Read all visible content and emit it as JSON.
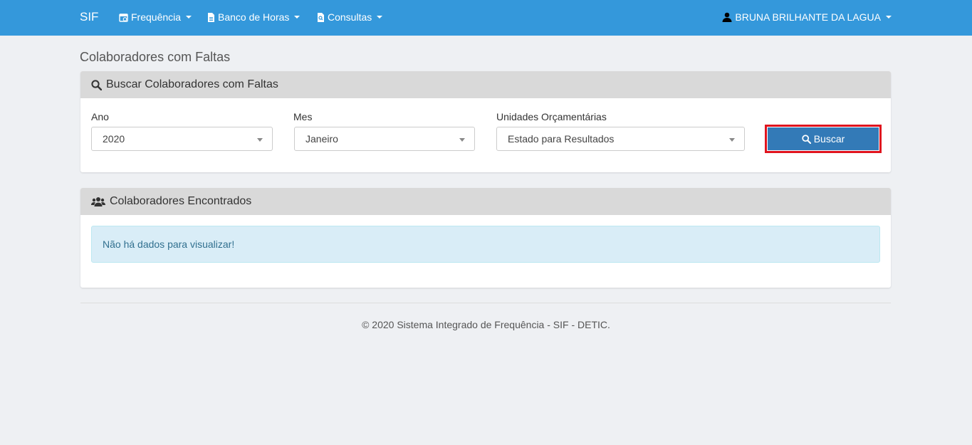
{
  "navbar": {
    "brand": "SIF",
    "items": [
      {
        "label": "Frequência"
      },
      {
        "label": "Banco de Horas"
      },
      {
        "label": "Consultas"
      }
    ],
    "user": "BRUNA BRILHANTE DA LAGUA"
  },
  "page": {
    "title": "Colaboradores com Faltas"
  },
  "search_panel": {
    "heading": "Buscar Colaboradores com Faltas",
    "ano_label": "Ano",
    "ano_value": "2020",
    "mes_label": "Mes",
    "mes_value": "Janeiro",
    "unidades_label": "Unidades Orçamentárias",
    "unidades_value": "Estado para Resultados",
    "search_button": "Buscar"
  },
  "results_panel": {
    "heading": "Colaboradores Encontrados",
    "empty_message": "Não há dados para visualizar!"
  },
  "footer": {
    "text": "© 2020 Sistema Integrado de Frequência - SIF - DETIC."
  }
}
